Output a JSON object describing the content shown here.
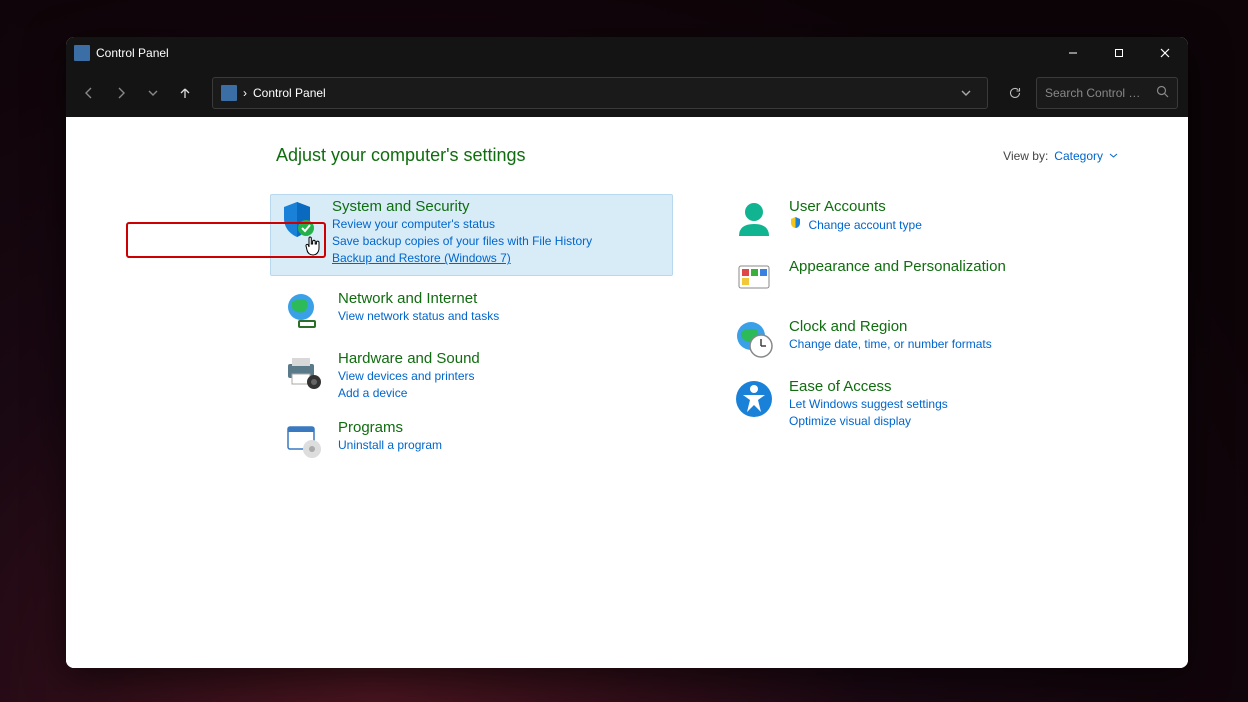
{
  "window": {
    "title": "Control Panel"
  },
  "addressbar": {
    "breadcrumb_sep": "›",
    "breadcrumb": "Control Panel"
  },
  "search": {
    "placeholder": "Search Control P..."
  },
  "header": {
    "heading": "Adjust your computer's settings",
    "viewby_label": "View by:",
    "viewby_value": "Category"
  },
  "categories": {
    "left": [
      {
        "title": "System and Security",
        "links": [
          "Review your computer's status",
          "Save backup copies of your files with File History",
          "Backup and Restore (Windows 7)"
        ]
      },
      {
        "title": "Network and Internet",
        "links": [
          "View network status and tasks"
        ]
      },
      {
        "title": "Hardware and Sound",
        "links": [
          "View devices and printers",
          "Add a device"
        ]
      },
      {
        "title": "Programs",
        "links": [
          "Uninstall a program"
        ]
      }
    ],
    "right": [
      {
        "title": "User Accounts",
        "links": [
          "Change account type"
        ],
        "shield": true
      },
      {
        "title": "Appearance and Personalization",
        "links": []
      },
      {
        "title": "Clock and Region",
        "links": [
          "Change date, time, or number formats"
        ]
      },
      {
        "title": "Ease of Access",
        "links": [
          "Let Windows suggest settings",
          "Optimize visual display"
        ]
      }
    ]
  }
}
